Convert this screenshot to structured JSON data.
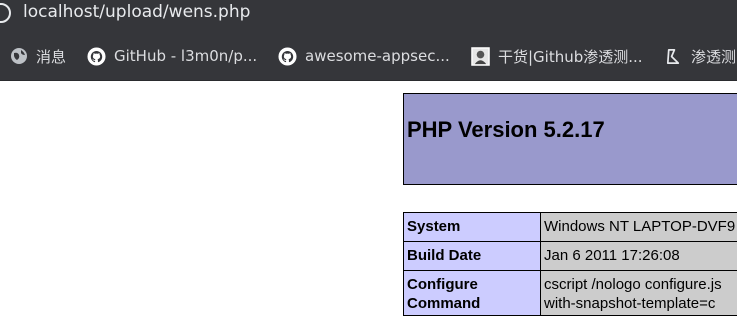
{
  "address_bar": {
    "url": "localhost/upload/wens.php"
  },
  "bookmarks": [
    {
      "label": "消息",
      "icon": "globe-icon"
    },
    {
      "label": "GitHub - l3m0n/p...",
      "icon": "github-icon"
    },
    {
      "label": "awesome-appsec...",
      "icon": "github-icon"
    },
    {
      "label": "干货|Github渗透测...",
      "icon": "portrait-icon"
    },
    {
      "label": "渗透测",
      "icon": "bookmark-icon"
    }
  ],
  "phpinfo": {
    "title": "PHP Version 5.2.17",
    "rows": [
      {
        "key": "System",
        "value": "Windows NT LAPTOP-DVF9"
      },
      {
        "key": "Build Date",
        "value": "Jan 6 2011 17:26:08"
      },
      {
        "key": "Configure Command",
        "value_line1": "cscript /nologo configure.js",
        "value_line2": "with-snapshot-template=c"
      }
    ]
  },
  "colors": {
    "chrome_bg": "#35363a",
    "php_header": "#9999cc",
    "php_key_cell": "#ccccff",
    "php_value_cell": "#cccccc"
  }
}
